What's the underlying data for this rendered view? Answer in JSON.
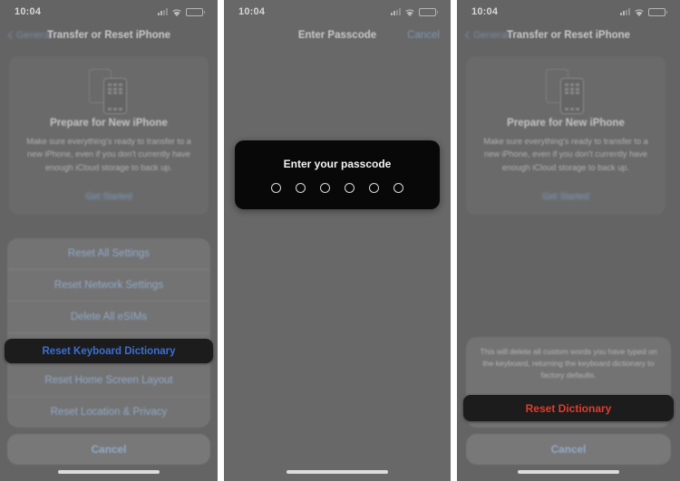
{
  "status_bar": {
    "time": "10:04",
    "icons": [
      "cellular-signal-icon",
      "wifi-icon",
      "battery-icon"
    ]
  },
  "colors": {
    "screen_bg": "#646464",
    "sheet_blue": "#8fa9c8",
    "highlight_bg": "#1c1c1c",
    "highlight_blue": "#3a6fd8",
    "destructive_red": "#e03c2e",
    "passcode_bg": "#080808"
  },
  "panels": [
    {
      "id": "panel-reset-options",
      "nav": {
        "back_label": "General",
        "title": "Transfer or Reset iPhone",
        "right_label": ""
      },
      "prepare_card": {
        "title": "Prepare for New iPhone",
        "body": "Make sure everything's ready to transfer to a new iPhone, even if you don't currently have enough iCloud storage to back up.",
        "link": "Get Started"
      },
      "action_sheet": {
        "options": [
          {
            "label": "Reset All Settings",
            "highlighted": false
          },
          {
            "label": "Reset Network Settings",
            "highlighted": false
          },
          {
            "label": "Delete All eSIMs",
            "highlighted": false
          },
          {
            "label": "Reset Keyboard Dictionary",
            "highlighted": true
          },
          {
            "label": "Reset Home Screen Layout",
            "highlighted": false
          },
          {
            "label": "Reset Location & Privacy",
            "highlighted": false
          }
        ],
        "cancel_label": "Cancel"
      }
    },
    {
      "id": "panel-enter-passcode",
      "nav": {
        "back_label": "",
        "title": "Enter Passcode",
        "right_label": "Cancel"
      },
      "passcode": {
        "prompt": "Enter your passcode",
        "digit_count": 6,
        "entered": 0
      }
    },
    {
      "id": "panel-confirm-reset",
      "nav": {
        "back_label": "General",
        "title": "Transfer or Reset iPhone",
        "right_label": ""
      },
      "prepare_card": {
        "title": "Prepare for New iPhone",
        "body": "Make sure everything's ready to transfer to a new iPhone, even if you don't currently have enough iCloud storage to back up.",
        "link": "Get Started"
      },
      "confirm_sheet": {
        "message": "This will delete all custom words you have typed on the keyboard, returning the keyboard dictionary to factory defaults.",
        "destructive_label": "Reset Dictionary",
        "cancel_label": "Cancel"
      }
    }
  ]
}
